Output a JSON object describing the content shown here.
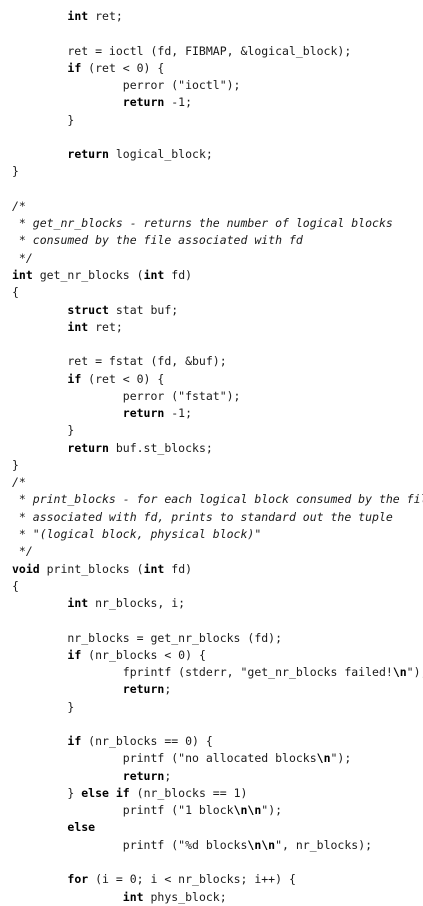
{
  "lines": [
    [
      {
        "t": "        "
      },
      {
        "t": "int",
        "k": "kw"
      },
      {
        "t": " ret;"
      }
    ],
    [],
    [
      {
        "t": "        ret = ioctl (fd, FIBMAP, &logical_block);"
      }
    ],
    [
      {
        "t": "        "
      },
      {
        "t": "if",
        "k": "kw"
      },
      {
        "t": " (ret < 0) {"
      }
    ],
    [
      {
        "t": "                perror (\"ioctl\");"
      }
    ],
    [
      {
        "t": "                "
      },
      {
        "t": "return",
        "k": "kw"
      },
      {
        "t": " -1;"
      }
    ],
    [
      {
        "t": "        }"
      }
    ],
    [],
    [
      {
        "t": "        "
      },
      {
        "t": "return",
        "k": "kw"
      },
      {
        "t": " logical_block;"
      }
    ],
    [
      {
        "t": "}"
      }
    ],
    [],
    [
      {
        "t": "/*",
        "k": "cm"
      }
    ],
    [
      {
        "t": " * get_nr_blocks - returns the number of logical blocks",
        "k": "cm"
      }
    ],
    [
      {
        "t": " * consumed by the file associated with fd",
        "k": "cm"
      }
    ],
    [
      {
        "t": " */",
        "k": "cm"
      }
    ],
    [
      {
        "t": "int",
        "k": "kw"
      },
      {
        "t": " get_nr_blocks ("
      },
      {
        "t": "int",
        "k": "kw"
      },
      {
        "t": " fd)"
      }
    ],
    [
      {
        "t": "{"
      }
    ],
    [
      {
        "t": "        "
      },
      {
        "t": "struct",
        "k": "kw"
      },
      {
        "t": " stat buf;"
      }
    ],
    [
      {
        "t": "        "
      },
      {
        "t": "int",
        "k": "kw"
      },
      {
        "t": " ret;"
      }
    ],
    [],
    [
      {
        "t": "        ret = fstat (fd, &buf);"
      }
    ],
    [
      {
        "t": "        "
      },
      {
        "t": "if",
        "k": "kw"
      },
      {
        "t": " (ret < 0) {"
      }
    ],
    [
      {
        "t": "                perror (\"fstat\");"
      }
    ],
    [
      {
        "t": "                "
      },
      {
        "t": "return",
        "k": "kw"
      },
      {
        "t": " -1;"
      }
    ],
    [
      {
        "t": "        }"
      }
    ],
    [
      {
        "t": "        "
      },
      {
        "t": "return",
        "k": "kw"
      },
      {
        "t": " buf.st_blocks;"
      }
    ],
    [
      {
        "t": "}"
      }
    ],
    [
      {
        "t": "/*",
        "k": "cm"
      }
    ],
    [
      {
        "t": " * print_blocks - for each logical block consumed by the file",
        "k": "cm"
      }
    ],
    [
      {
        "t": " * associated with fd, prints to standard out the tuple",
        "k": "cm"
      }
    ],
    [
      {
        "t": " * \"(logical block, physical block)\"",
        "k": "cm"
      }
    ],
    [
      {
        "t": " */",
        "k": "cm"
      }
    ],
    [
      {
        "t": "void",
        "k": "kw"
      },
      {
        "t": " print_blocks ("
      },
      {
        "t": "int",
        "k": "kw"
      },
      {
        "t": " fd)"
      }
    ],
    [
      {
        "t": "{"
      }
    ],
    [
      {
        "t": "        "
      },
      {
        "t": "int",
        "k": "kw"
      },
      {
        "t": " nr_blocks, i;"
      }
    ],
    [],
    [
      {
        "t": "        nr_blocks = get_nr_blocks (fd);"
      }
    ],
    [
      {
        "t": "        "
      },
      {
        "t": "if",
        "k": "kw"
      },
      {
        "t": " (nr_blocks < 0) {"
      }
    ],
    [
      {
        "t": "                fprintf (stderr, \"get_nr_blocks failed!"
      },
      {
        "t": "\\n",
        "k": "esc"
      },
      {
        "t": "\");"
      }
    ],
    [
      {
        "t": "                "
      },
      {
        "t": "return",
        "k": "kw"
      },
      {
        "t": ";"
      }
    ],
    [
      {
        "t": "        }"
      }
    ],
    [],
    [
      {
        "t": "        "
      },
      {
        "t": "if",
        "k": "kw"
      },
      {
        "t": " (nr_blocks == 0) {"
      }
    ],
    [
      {
        "t": "                printf (\"no allocated blocks"
      },
      {
        "t": "\\n",
        "k": "esc"
      },
      {
        "t": "\");"
      }
    ],
    [
      {
        "t": "                "
      },
      {
        "t": "return",
        "k": "kw"
      },
      {
        "t": ";"
      }
    ],
    [
      {
        "t": "        } "
      },
      {
        "t": "else if",
        "k": "kw"
      },
      {
        "t": " (nr_blocks == 1)"
      }
    ],
    [
      {
        "t": "                printf (\"1 block"
      },
      {
        "t": "\\n\\n",
        "k": "esc"
      },
      {
        "t": "\");"
      }
    ],
    [
      {
        "t": "        "
      },
      {
        "t": "else",
        "k": "kw"
      }
    ],
    [
      {
        "t": "                printf (\"%d blocks"
      },
      {
        "t": "\\n\\n",
        "k": "esc"
      },
      {
        "t": "\", nr_blocks);"
      }
    ],
    [],
    [
      {
        "t": "        "
      },
      {
        "t": "for",
        "k": "kw"
      },
      {
        "t": " (i = 0; i < nr_blocks; i++) {"
      }
    ],
    [
      {
        "t": "                "
      },
      {
        "t": "int",
        "k": "kw"
      },
      {
        "t": " phys_block;"
      }
    ]
  ]
}
